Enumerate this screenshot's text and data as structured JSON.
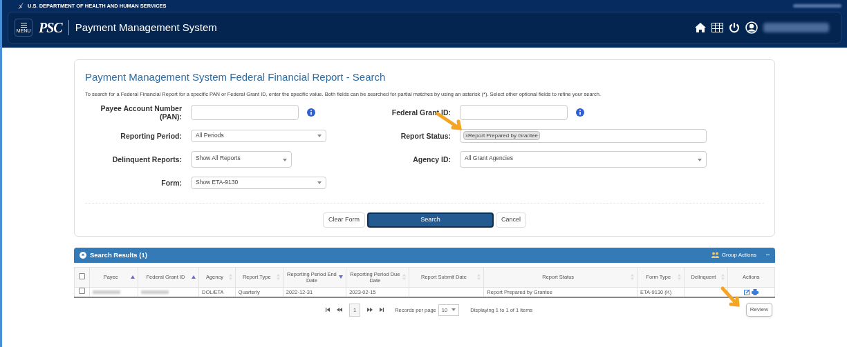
{
  "agency_bar": {
    "title": "U.S. DEPARTMENT OF HEALTH AND HUMAN SERVICES"
  },
  "header": {
    "menu_label": "MENU",
    "logo": "PSC",
    "title": "Payment Management System"
  },
  "search_card": {
    "title": "Payment Management System Federal Financial Report - Search",
    "description": "To search for a Federal Financial Report for a specific PAN or Federal Grant ID, enter the specific value. Both fields can be searched for partial matches by using an asterisk (*). Select other optional fields to refine your search.",
    "left_fields": [
      {
        "kind": "text",
        "label": "Payee Account Number (PAN):",
        "info": true
      },
      {
        "kind": "select",
        "label": "Reporting Period:",
        "value": "All Periods"
      },
      {
        "kind": "select",
        "label": "Delinquent Reports:",
        "value": "Show All Reports"
      },
      {
        "kind": "select",
        "label": "Form:",
        "value": "Show ETA-9130"
      }
    ],
    "right_fields": [
      {
        "kind": "text",
        "label": "Federal Grant ID:",
        "info": true
      },
      {
        "kind": "tags",
        "label": "Report Status:",
        "tags": [
          {
            "remove": "×",
            "text": "Report Prepared by Grantee"
          }
        ]
      },
      {
        "kind": "select",
        "label": "Agency ID:",
        "value": "All Grant Agencies"
      }
    ],
    "buttons": [
      {
        "label": "Clear Form",
        "primary": false
      },
      {
        "label": "Search",
        "primary": true
      },
      {
        "label": "Cancel",
        "primary": false
      }
    ]
  },
  "results": {
    "title": "Search Results (1)",
    "group_actions": "Group Actions",
    "header_checked": false,
    "columns": [
      {
        "label": "Payee",
        "kind": "ascending"
      },
      {
        "label": "Federal Grant ID",
        "kind": "ascending"
      },
      {
        "label": "Agency",
        "kind": "unsorted"
      },
      {
        "label": "Report Type",
        "kind": "unsorted"
      },
      {
        "label": "Reporting Period End Date",
        "kind": "descending"
      },
      {
        "label": "Reporting Period Due Date",
        "kind": "unsorted"
      },
      {
        "label": "Report Submit Date",
        "kind": "unsorted"
      },
      {
        "label": "Report Status",
        "kind": "unsorted"
      },
      {
        "label": "Form Type",
        "kind": "unsorted"
      },
      {
        "label": "Delinquent",
        "kind": "unsorted"
      },
      {
        "label": "Actions",
        "kind": "plain"
      }
    ],
    "rows": [
      {
        "checked": false,
        "cells": [
          "",
          "",
          "DOL/ETA",
          "Quarterly",
          "2022-12-31",
          "2023-02-15",
          "",
          "Report Prepared by Grantee",
          "ETA-9130 (K)",
          ""
        ]
      }
    ],
    "pager": {
      "page": "1",
      "records_label": "Records per page",
      "per_page": "10",
      "displaying": "Displaying 1 to 1 of 1 items"
    },
    "tooltip": "Review"
  }
}
